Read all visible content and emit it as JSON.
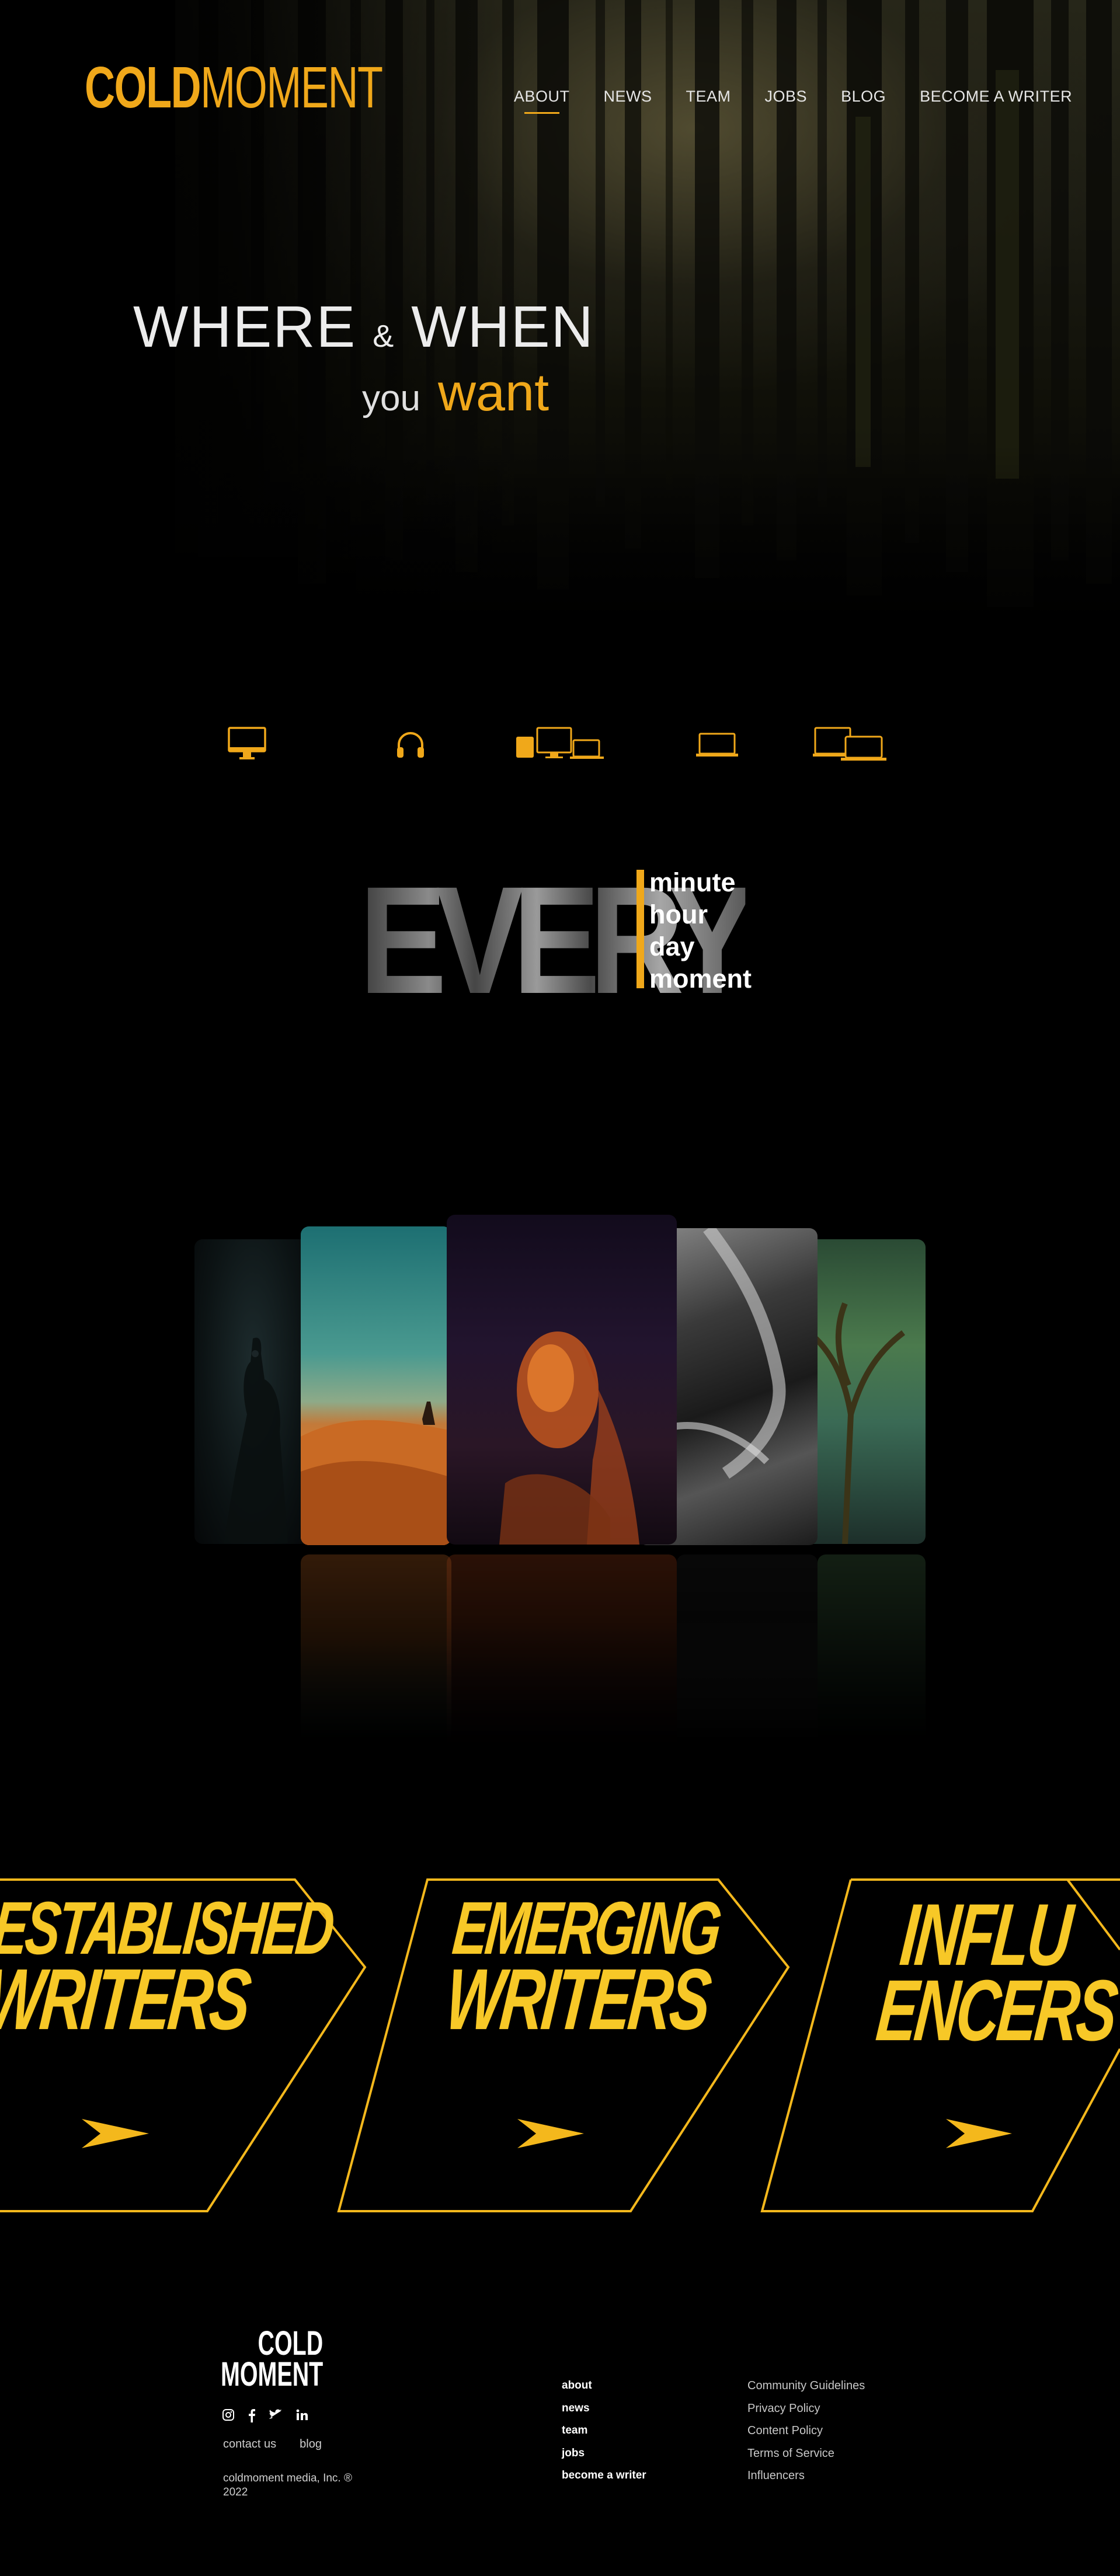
{
  "brand": {
    "logo_bold": "COLD",
    "logo_light": "MOMENT"
  },
  "nav": {
    "items": [
      "ABOUT",
      "NEWS",
      "TEAM",
      "JOBS",
      "BLOG",
      "BECOME A WRITER"
    ],
    "active": "ABOUT"
  },
  "hero": {
    "line1_a": "WHERE",
    "line1_amp": "&",
    "line1_b": "WHEN",
    "line2_a": "you",
    "line2_b": "want"
  },
  "devices": [
    "desktop-icon",
    "headphones-icon",
    "multi-device-icon",
    "laptop-icon",
    "laptop-tablet-icon"
  ],
  "every": {
    "word": "EVERY",
    "list": [
      "minute",
      "hour",
      "day",
      "moment"
    ]
  },
  "cards": [
    "dark-figure-photo",
    "desert-photo",
    "portrait-photo",
    "monochrome-photo",
    "forest-photo"
  ],
  "writers": [
    {
      "line1": "ESTABLISHED",
      "line2": "WRITERS"
    },
    {
      "line1": "EMERGING",
      "line2": "WRITERS"
    },
    {
      "line1": "INFLU",
      "line2": "ENCERS"
    }
  ],
  "footer": {
    "logo_line1": "COLD",
    "logo_line2": "MOMENT",
    "social": [
      "instagram-icon",
      "facebook-icon",
      "twitter-icon",
      "linkedin-icon"
    ],
    "links": [
      "contact us",
      "blog"
    ],
    "copyright": "coldmoment media, Inc. ® 2022",
    "col1": [
      "about",
      "news",
      "team",
      "jobs",
      "become a writer"
    ],
    "col2": [
      "Community Guidelines",
      "Privacy Policy",
      "Content Policy",
      "Terms of Service",
      "Influencers"
    ]
  },
  "colors": {
    "accent": "#f0a81a",
    "writers": "#f7c827",
    "background": "#000000"
  }
}
